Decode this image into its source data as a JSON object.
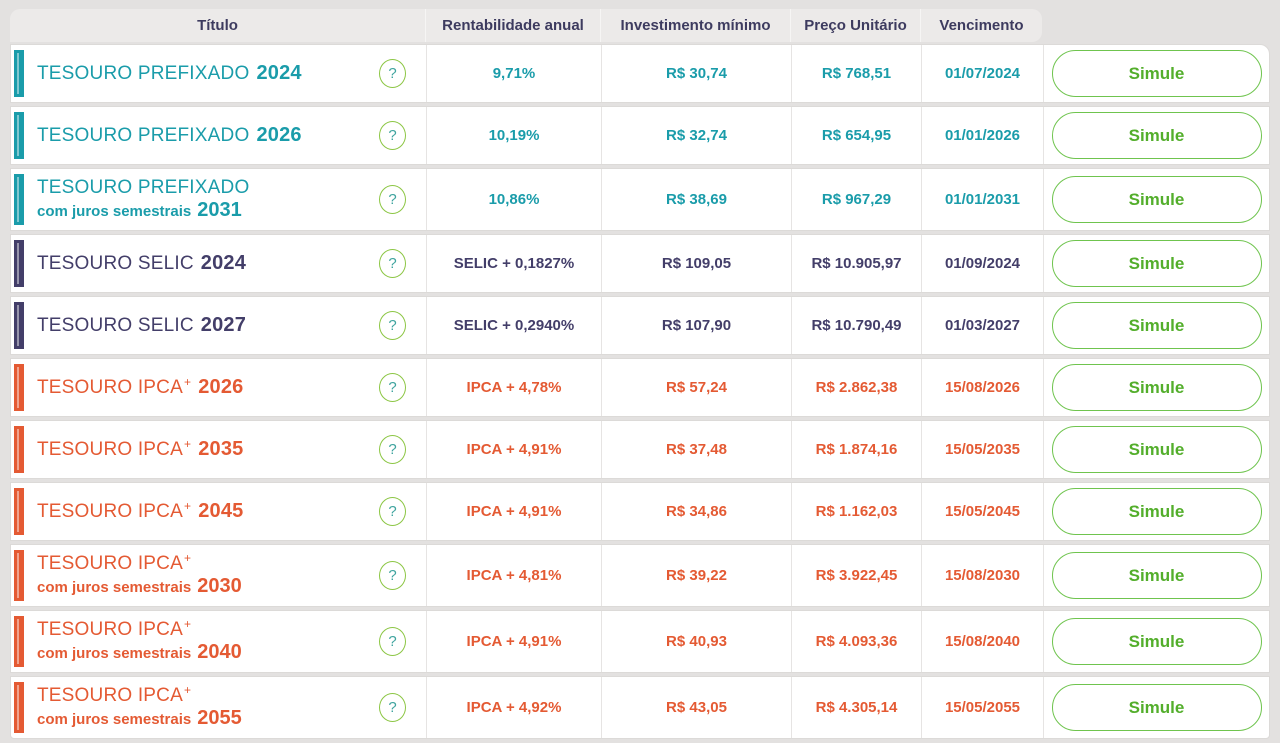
{
  "help_glyph": "?",
  "colors": {
    "teal": "#1a9caa",
    "navy": "#433e69",
    "orange": "#e45a33",
    "button_green_border": "#6fc44e",
    "button_green_text": "#53ae2b",
    "help_circle_green": "#8cc644",
    "header_bg": "#eceae9",
    "header_text": "#3d3b5f",
    "page_bg": "#e3e1e0"
  },
  "table": {
    "columns": [
      "Título",
      "Rentabilidade anual",
      "Investimento mínimo",
      "Preço Unitário",
      "Vencimento"
    ],
    "rows": [
      {
        "theme": "teal",
        "name": "TESOURO PREFIXADO",
        "sup": "",
        "subtitle": "",
        "year_line1": "2024",
        "year_line2": "",
        "rate": "9,71%",
        "min": "R$ 30,74",
        "price": "R$ 768,51",
        "maturity": "01/07/2024",
        "action": "Simule"
      },
      {
        "theme": "teal",
        "name": "TESOURO PREFIXADO",
        "sup": "",
        "subtitle": "",
        "year_line1": "2026",
        "year_line2": "",
        "rate": "10,19%",
        "min": "R$ 32,74",
        "price": "R$ 654,95",
        "maturity": "01/01/2026",
        "action": "Simule"
      },
      {
        "theme": "teal",
        "name": "TESOURO PREFIXADO",
        "sup": "",
        "subtitle": "com juros semestrais",
        "year_line1": "",
        "year_line2": "2031",
        "rate": "10,86%",
        "min": "R$ 38,69",
        "price": "R$ 967,29",
        "maturity": "01/01/2031",
        "action": "Simule"
      },
      {
        "theme": "navy",
        "name": "TESOURO SELIC",
        "sup": "",
        "subtitle": "",
        "year_line1": "2024",
        "year_line2": "",
        "rate": "SELIC + 0,1827%",
        "min": "R$ 109,05",
        "price": "R$ 10.905,97",
        "maturity": "01/09/2024",
        "action": "Simule"
      },
      {
        "theme": "navy",
        "name": "TESOURO SELIC",
        "sup": "",
        "subtitle": "",
        "year_line1": "2027",
        "year_line2": "",
        "rate": "SELIC + 0,2940%",
        "min": "R$ 107,90",
        "price": "R$ 10.790,49",
        "maturity": "01/03/2027",
        "action": "Simule"
      },
      {
        "theme": "orange",
        "name": "TESOURO IPCA",
        "sup": "+",
        "subtitle": "",
        "year_line1": "2026",
        "year_line2": "",
        "rate": "IPCA + 4,78%",
        "min": "R$ 57,24",
        "price": "R$ 2.862,38",
        "maturity": "15/08/2026",
        "action": "Simule"
      },
      {
        "theme": "orange",
        "name": "TESOURO IPCA",
        "sup": "+",
        "subtitle": "",
        "year_line1": "2035",
        "year_line2": "",
        "rate": "IPCA + 4,91%",
        "min": "R$ 37,48",
        "price": "R$ 1.874,16",
        "maturity": "15/05/2035",
        "action": "Simule"
      },
      {
        "theme": "orange",
        "name": "TESOURO IPCA",
        "sup": "+",
        "subtitle": "",
        "year_line1": "2045",
        "year_line2": "",
        "rate": "IPCA + 4,91%",
        "min": "R$ 34,86",
        "price": "R$ 1.162,03",
        "maturity": "15/05/2045",
        "action": "Simule"
      },
      {
        "theme": "orange",
        "name": "TESOURO IPCA",
        "sup": "+",
        "subtitle": "com juros semestrais",
        "year_line1": "",
        "year_line2": "2030",
        "rate": "IPCA + 4,81%",
        "min": "R$ 39,22",
        "price": "R$ 3.922,45",
        "maturity": "15/08/2030",
        "action": "Simule"
      },
      {
        "theme": "orange",
        "name": "TESOURO IPCA",
        "sup": "+",
        "subtitle": "com juros semestrais",
        "year_line1": "",
        "year_line2": "2040",
        "rate": "IPCA + 4,91%",
        "min": "R$ 40,93",
        "price": "R$ 4.093,36",
        "maturity": "15/08/2040",
        "action": "Simule"
      },
      {
        "theme": "orange",
        "name": "TESOURO IPCA",
        "sup": "+",
        "subtitle": "com juros semestrais",
        "year_line1": "",
        "year_line2": "2055",
        "rate": "IPCA + 4,92%",
        "min": "R$ 43,05",
        "price": "R$ 4.305,14",
        "maturity": "15/05/2055",
        "action": "Simule"
      }
    ]
  }
}
